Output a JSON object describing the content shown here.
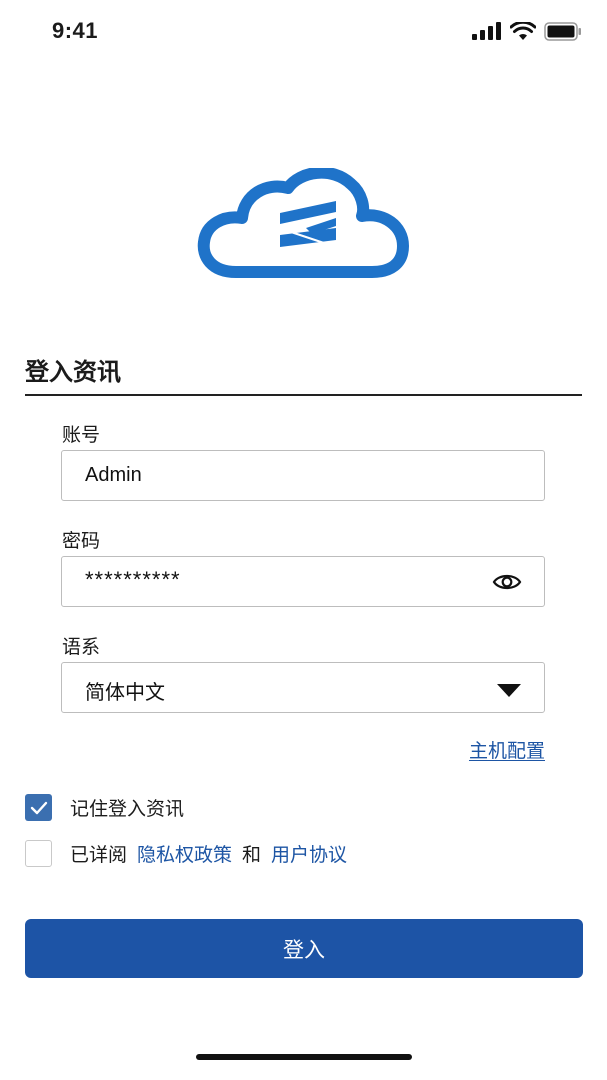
{
  "status_bar": {
    "time": "9:41"
  },
  "form": {
    "section_title": "登入资讯",
    "account": {
      "label": "账号",
      "value": "Admin"
    },
    "password": {
      "label": "密码",
      "value": "**********"
    },
    "language": {
      "label": "语系",
      "selected": "简体中文"
    },
    "host_config_link": "主机配置"
  },
  "options": {
    "remember": {
      "label": "记住登入资讯",
      "checked": true
    },
    "agreement": {
      "prefix": "已详阅",
      "privacy_link": "隐私权政策",
      "conjunction": "和",
      "terms_link": "用户协议",
      "checked": false
    }
  },
  "login_button": "登入",
  "colors": {
    "brand_blue": "#1d54a6",
    "logo_blue": "#1f73c9",
    "link_blue": "#1d55a4"
  }
}
